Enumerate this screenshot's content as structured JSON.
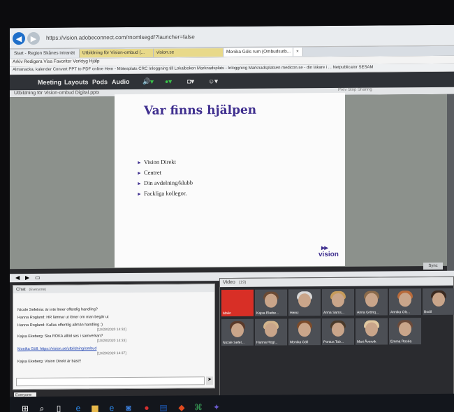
{
  "browser": {
    "url": "https://vision.adobeconnect.com/rnomlsegd/?launcher=false",
    "tabs": [
      "Start - Region Skånes intranät",
      "Utbildning för Vision-ombud (...",
      "vision.se",
      "Monika Göls rum (Ombudsutb...",
      "×"
    ],
    "menu": "Arkiv   Redigera   Visa   Favoriter   Verktyg   Hjälp",
    "favorites": "Almanacka, kalender  Convert PPT to PDF online  Hem - Mötesplats CRC  Inloggning till Lokalboken  Marknadsplats - Inloggning  Marknadsplatsen  medicon.se - din läkare i ...  Netpublicator  SESAM"
  },
  "connect": {
    "menu": [
      "Meeting",
      "Layouts",
      "Pods",
      "Audio"
    ],
    "pod_title": "Utbildning för Vision-ombud Digital.pptx",
    "pod_buttons": "Prev   Stop Sharing",
    "sync": "Sync"
  },
  "slide": {
    "title": "Var finns hjälpen",
    "bullets": [
      "Vision Direkt",
      "Centret",
      "Din avdelning/klubb",
      "Fackliga kollegor."
    ],
    "logo": "vision"
  },
  "chat": {
    "title": "Chat",
    "scope": "(Everyone)",
    "messages": [
      {
        "text": "Nicole Sefelnia: är inte löner offentlig handling?",
        "time": ""
      },
      {
        "text": "Hanna Rogland: HR lämnar ut löner om man begär ut",
        "time": ""
      },
      {
        "text": "Hanna Rogland: Kallas offentlig allmän handling :)",
        "time": "[10/28/2020 14:32]"
      },
      {
        "text": "Kajsa Ekeberg: Ska ROKA alltid ses i samverkan?",
        "time": "[10/28/2020 14:33]"
      },
      {
        "text": "Monika Göll: https://vision.se/utbildning/ombud",
        "time": "[10/28/2020 14:37]"
      },
      {
        "text": "Kajsa Ekeberg: Vision Direkt är bäst!!",
        "time": ""
      }
    ],
    "everyone_tab": "Everyone"
  },
  "video": {
    "title": "Video",
    "count": "(19)",
    "row1": [
      "Malin",
      "Kajsa Ekebe...",
      "Heinz",
      "Anna Sams...",
      "Anna Grönq...",
      "Annika Ols...",
      "Bodil"
    ],
    "row2": [
      "Nicole Sefel...",
      "Hanna Rogl...",
      "Monika Göll",
      "Pontus Tob...",
      "Mari Åvervik",
      "Emma Roséa"
    ]
  },
  "colors": {
    "slide_title": "#3f2f8f",
    "active_speaker": "#d82f26",
    "browser_accent": "#1f6fc9"
  }
}
